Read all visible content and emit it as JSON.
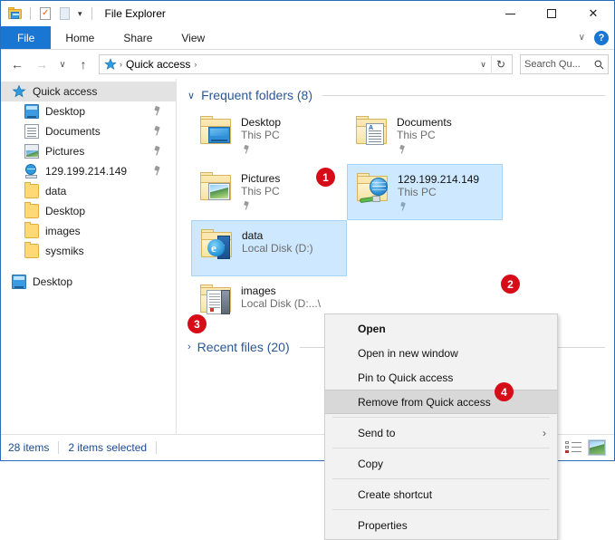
{
  "window": {
    "title": "File Explorer",
    "quick_access_toolbar": [
      {
        "name": "explorer-icon",
        "label": "File Explorer"
      },
      {
        "name": "properties-icon",
        "label": "Properties"
      },
      {
        "name": "new-folder-icon",
        "label": "New folder"
      }
    ],
    "caret": "▾",
    "controls": {
      "minimize": "–",
      "maximize": "□",
      "close": "✕"
    }
  },
  "ribbon": {
    "tabs": [
      {
        "label": "File",
        "active": true
      },
      {
        "label": "Home",
        "active": false
      },
      {
        "label": "Share",
        "active": false
      },
      {
        "label": "View",
        "active": false
      }
    ],
    "collapse_caret": "∨",
    "help_label": "?"
  },
  "addressbar": {
    "back": "←",
    "forward": "→",
    "recent": "∨",
    "up": "↑",
    "breadcrumb": [
      {
        "label": "Quick access",
        "icon": "star-icon"
      }
    ],
    "separator": "›",
    "dropdown": "∨",
    "refresh": "↻",
    "search": {
      "placeholder": "Search Qu...",
      "value": ""
    }
  },
  "navpane": {
    "items": [
      {
        "label": "Quick access",
        "icon": "star-icon",
        "selected": true,
        "pinned": false,
        "indent": false
      },
      {
        "label": "Desktop",
        "icon": "desktop-icon",
        "selected": false,
        "pinned": true,
        "indent": true
      },
      {
        "label": "Documents",
        "icon": "documents-icon",
        "selected": false,
        "pinned": true,
        "indent": true
      },
      {
        "label": "Pictures",
        "icon": "pictures-icon",
        "selected": false,
        "pinned": true,
        "indent": true
      },
      {
        "label": "129.199.214.149",
        "icon": "network-icon",
        "selected": false,
        "pinned": true,
        "indent": true
      },
      {
        "label": "data",
        "icon": "folder-icon",
        "selected": false,
        "pinned": false,
        "indent": true
      },
      {
        "label": "Desktop",
        "icon": "folder-icon",
        "selected": false,
        "pinned": false,
        "indent": true
      },
      {
        "label": "images",
        "icon": "folder-icon",
        "selected": false,
        "pinned": false,
        "indent": true
      },
      {
        "label": "sysmiks",
        "icon": "folder-icon",
        "selected": false,
        "pinned": false,
        "indent": true
      }
    ],
    "bottom_item": {
      "label": "Desktop",
      "icon": "desktop-icon"
    }
  },
  "main": {
    "groups": [
      {
        "chevron": "∨",
        "title": "Frequent folders (8)",
        "expanded": true
      },
      {
        "chevron": "›",
        "title": "Recent files (20)",
        "expanded": false
      }
    ],
    "tiles": [
      {
        "name": "Desktop",
        "sub": "This PC",
        "icon": "folder-desktop-icon",
        "pinned": true,
        "selected": false
      },
      {
        "name": "Documents",
        "sub": "This PC",
        "icon": "folder-documents-icon",
        "pinned": true,
        "selected": false
      },
      {
        "name": "Pictures",
        "sub": "This PC",
        "icon": "folder-pictures-icon",
        "pinned": true,
        "selected": false
      },
      {
        "name": "129.199.214.149",
        "sub": "This PC",
        "icon": "folder-network-icon",
        "pinned": true,
        "selected": true
      },
      {
        "name": "data",
        "sub": "Local Disk (D:)",
        "icon": "folder-data-icon",
        "pinned": false,
        "selected": true
      },
      {
        "name": "images",
        "sub": "Local Disk (D:...\\",
        "icon": "folder-images-icon",
        "pinned": false,
        "selected": false
      }
    ]
  },
  "context_menu": {
    "items": [
      {
        "label": "Open",
        "bold": true,
        "highlighted": false,
        "submenu": false,
        "separator_before": false
      },
      {
        "label": "Open in new window",
        "bold": false,
        "highlighted": false,
        "submenu": false,
        "separator_before": false
      },
      {
        "label": "Pin to Quick access",
        "bold": false,
        "highlighted": false,
        "submenu": false,
        "separator_before": false
      },
      {
        "label": "Remove from Quick access",
        "bold": false,
        "highlighted": true,
        "submenu": false,
        "separator_before": false
      },
      {
        "label": "Send to",
        "bold": false,
        "highlighted": false,
        "submenu": true,
        "separator_before": true
      },
      {
        "label": "Copy",
        "bold": false,
        "highlighted": false,
        "submenu": false,
        "separator_before": true
      },
      {
        "label": "Create shortcut",
        "bold": false,
        "highlighted": false,
        "submenu": false,
        "separator_before": true
      },
      {
        "label": "Properties",
        "bold": false,
        "highlighted": false,
        "submenu": false,
        "separator_before": true
      }
    ],
    "submenu_arrow": "›"
  },
  "statusbar": {
    "item_count": "28 items",
    "selection": "2 items selected",
    "views": [
      {
        "name": "details-view-button",
        "active": false
      },
      {
        "name": "large-icons-view-button",
        "active": true
      }
    ]
  },
  "badges": [
    {
      "number": "1",
      "target": "frequent-folders-header"
    },
    {
      "number": "2",
      "target": "tile-129.199.214.149"
    },
    {
      "number": "3",
      "target": "tile-data"
    },
    {
      "number": "4",
      "target": "menu-remove-from-quick-access"
    }
  ],
  "colors": {
    "accent": "#1976d2",
    "badge_red": "#d60c18",
    "selection_blue": "#cde8ff",
    "group_header_blue": "#2b5797",
    "status_text_blue": "#1b4b8f"
  }
}
